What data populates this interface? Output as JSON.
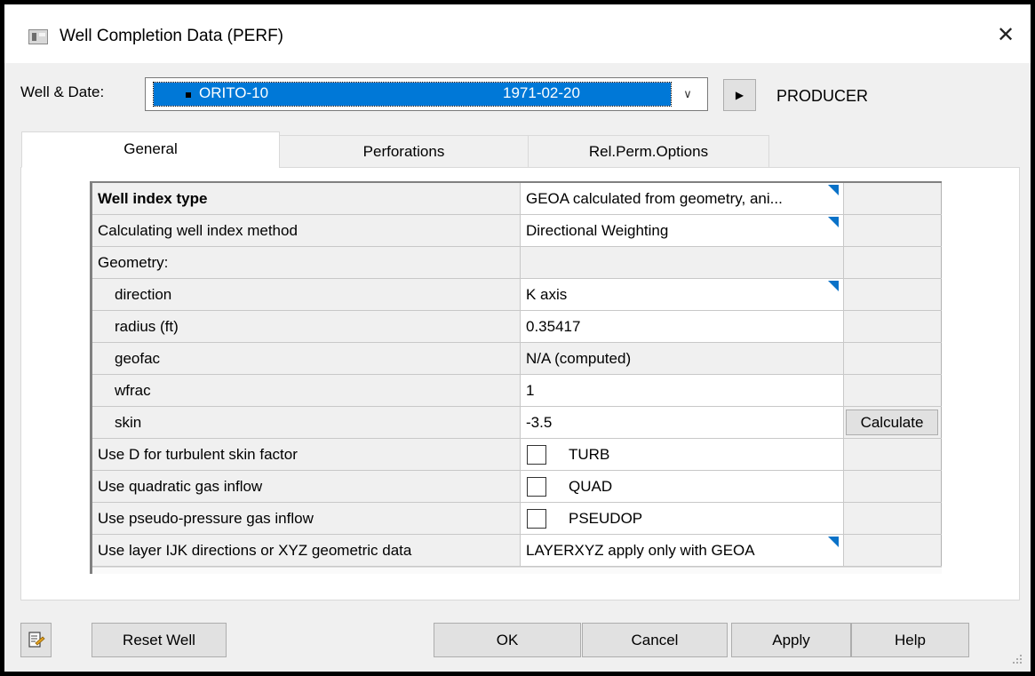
{
  "window": {
    "title": "Well Completion Data (PERF)"
  },
  "selector": {
    "label": "Well & Date:",
    "well": "ORITO-10",
    "date": "1971-02-20",
    "status": "PRODUCER"
  },
  "tabs": [
    {
      "label": "General"
    },
    {
      "label": "Perforations"
    },
    {
      "label": "Rel.Perm.Options"
    }
  ],
  "grid": {
    "rows": [
      {
        "label": "Well index type",
        "value": "GEOA calculated from geometry, ani..."
      },
      {
        "label": "Calculating well index method",
        "value": "Directional Weighting"
      },
      {
        "label": "Geometry:",
        "value": ""
      },
      {
        "label": "direction",
        "value": "K axis"
      },
      {
        "label": "radius (ft)",
        "value": "0.35417"
      },
      {
        "label": "geofac",
        "value": "N/A (computed)"
      },
      {
        "label": "wfrac",
        "value": "1"
      },
      {
        "label": "skin",
        "value": "-3.5",
        "action": "Calculate"
      },
      {
        "label": "Use D for turbulent skin factor",
        "value": "TURB",
        "checked": false
      },
      {
        "label": "Use quadratic gas inflow",
        "value": "QUAD",
        "checked": false
      },
      {
        "label": "Use pseudo-pressure gas inflow",
        "value": "PSEUDOP",
        "checked": false
      },
      {
        "label": "Use layer IJK directions or XYZ geometric data",
        "value": "LAYERXYZ apply only with GEOA"
      }
    ]
  },
  "buttons": {
    "reset": "Reset Well",
    "ok": "OK",
    "cancel": "Cancel",
    "apply": "Apply",
    "help": "Help"
  },
  "icons": {
    "app": "window-app-icon",
    "close": "close-icon",
    "play": "play-arrow-icon",
    "dropdown": "chevron-down-icon",
    "notes": "notes-edit-icon",
    "grip": "resize-grip-icon",
    "cell_dropdown": "dropdown-corner-icon"
  },
  "colors": {
    "selection": "#0078d7",
    "dropdown_corner": "#0a72c8",
    "dialog_bg": "#f0f0f0"
  }
}
